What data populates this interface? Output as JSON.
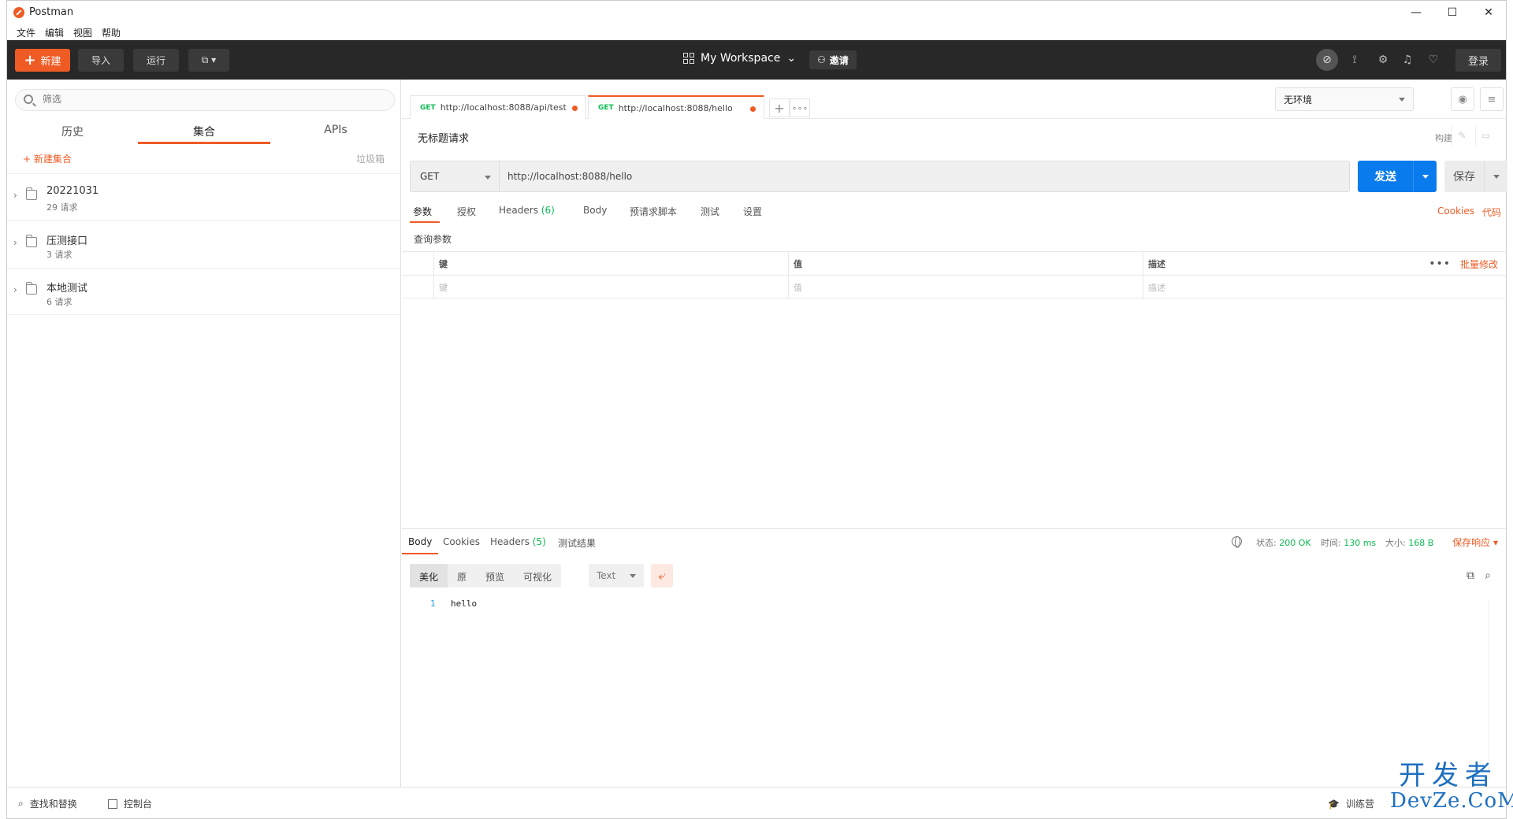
{
  "window": {
    "title": "Postman",
    "controls": {
      "minimize": "—",
      "maximize": "☐",
      "close": "✕"
    }
  },
  "menu": [
    "文件",
    "编辑",
    "视图",
    "帮助"
  ],
  "header": {
    "new_label": "新建",
    "import_label": "导入",
    "runner_label": "运行",
    "workspace_label": "My Workspace",
    "invite_label": "邀请",
    "login_label": "登录"
  },
  "sidebar": {
    "filter_placeholder": "筛选",
    "tabs": [
      {
        "label": "历史"
      },
      {
        "label": "集合"
      },
      {
        "label": "APIs"
      }
    ],
    "active_tab": "集合",
    "new_collection_label": "+ 新建集合",
    "trash_label": "垃圾箱",
    "collections": [
      {
        "name": "20221031",
        "count": "29 请求"
      },
      {
        "name": "压测接口",
        "count": "3 请求"
      },
      {
        "name": "本地测试",
        "count": "6 请求"
      }
    ]
  },
  "request_tabs": [
    {
      "method": "GET",
      "url": "http://localhost:8088/api/test"
    },
    {
      "method": "GET",
      "url": "http://localhost:8088/hello"
    }
  ],
  "environment": {
    "selected": "无环境"
  },
  "request": {
    "title": "无标题请求",
    "build_label": "构建",
    "method": "GET",
    "url": "http://localhost:8088/hello",
    "send_label": "发送",
    "save_label": "保存",
    "tabs": [
      {
        "label": "参数"
      },
      {
        "label": "授权"
      },
      {
        "label": "Headers",
        "count": "(6)"
      },
      {
        "label": "Body"
      },
      {
        "label": "预请求脚本"
      },
      {
        "label": "测试"
      },
      {
        "label": "设置"
      }
    ],
    "cookies_label": "Cookies",
    "code_label": "代码",
    "query_title": "查询参数",
    "params_table": {
      "headers": {
        "key": "键",
        "value": "值",
        "description": "描述"
      },
      "placeholder": {
        "key": "键",
        "value": "值",
        "description": "描述"
      },
      "bulk_edit_label": "批量修改"
    }
  },
  "response": {
    "tabs": [
      {
        "label": "Body"
      },
      {
        "label": "Cookies"
      },
      {
        "label": "Headers",
        "count": "(5)"
      },
      {
        "label": "测试结果"
      }
    ],
    "status_label": "状态:",
    "status_value": "200 OK",
    "time_label": "时间:",
    "time_value": "130 ms",
    "size_label": "大小:",
    "size_value": "168 B",
    "save_response_label": "保存响应",
    "view_modes": [
      "美化",
      "原",
      "预览",
      "可视化"
    ],
    "format": "Text",
    "lines": [
      {
        "number": "1",
        "text": "hello"
      }
    ]
  },
  "footer": {
    "find_replace_label": "查找和替换",
    "console_label": "控制台",
    "bootcamp_label": "训练营"
  },
  "watermark": {
    "line1": "开发者",
    "line2": "DevZe.CoM"
  },
  "colors": {
    "accent": "#ef5b25",
    "send": "#097bed",
    "success": "#0cbb52",
    "header_bg": "#282828"
  }
}
